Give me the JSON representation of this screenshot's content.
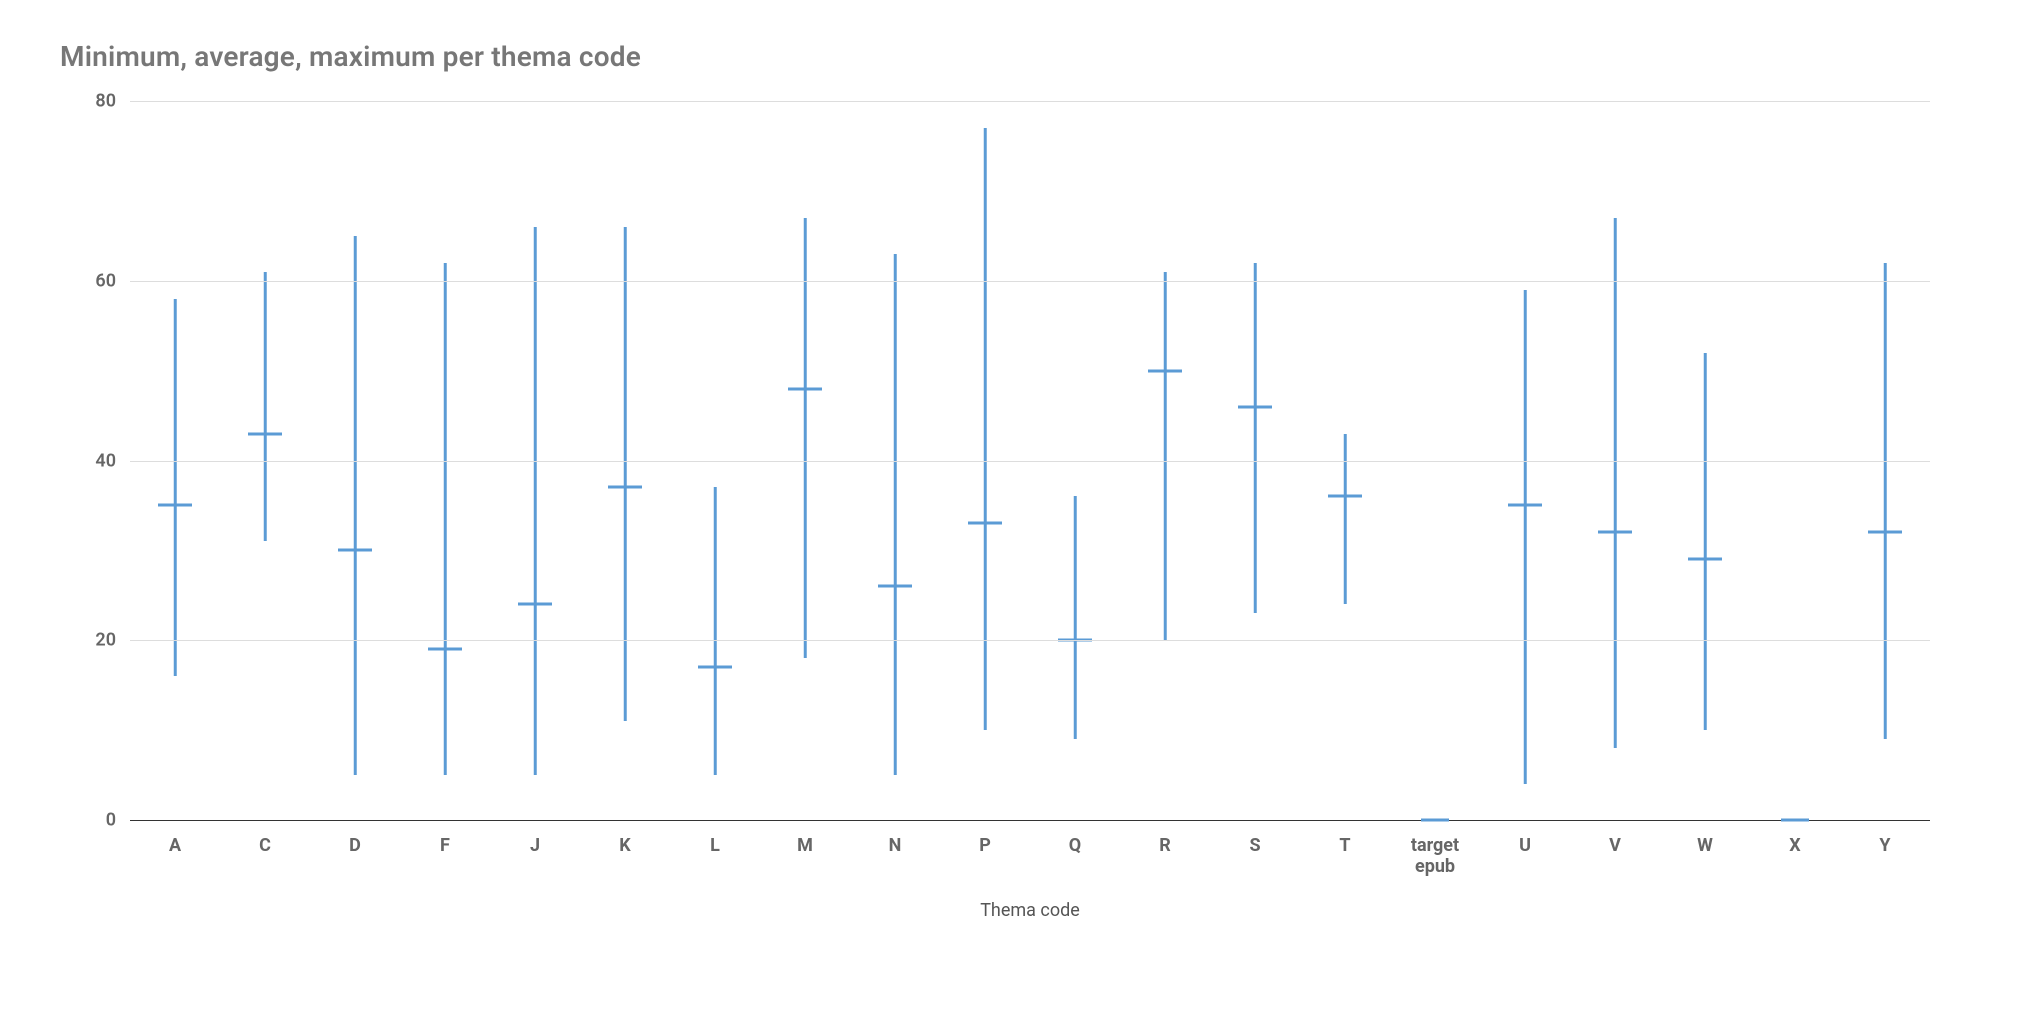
{
  "chart_data": {
    "type": "range_avg",
    "title": "Minimum, average, maximum per thema code",
    "xlabel": "Thema code",
    "ylabel": "",
    "ymin": 0,
    "ymax": 80,
    "yticks": [
      0,
      20,
      40,
      60,
      80
    ],
    "categories": [
      "A",
      "C",
      "D",
      "F",
      "J",
      "K",
      "L",
      "M",
      "N",
      "P",
      "Q",
      "R",
      "S",
      "T",
      "target epub",
      "U",
      "V",
      "W",
      "X",
      "Y"
    ],
    "series": {
      "min": [
        16,
        31,
        5,
        5,
        5,
        11,
        5,
        18,
        5,
        10,
        9,
        20,
        23,
        24,
        0,
        4,
        8,
        10,
        0,
        9
      ],
      "average": [
        35,
        43,
        30,
        19,
        24,
        37,
        17,
        48,
        26,
        33,
        20,
        50,
        46,
        36,
        0,
        35,
        32,
        29,
        0,
        32
      ],
      "max": [
        58,
        61,
        65,
        62,
        66,
        66,
        37,
        67,
        63,
        77,
        36,
        61,
        62,
        43,
        0,
        59,
        67,
        52,
        0,
        62
      ]
    },
    "color": "#5b9bd5"
  }
}
